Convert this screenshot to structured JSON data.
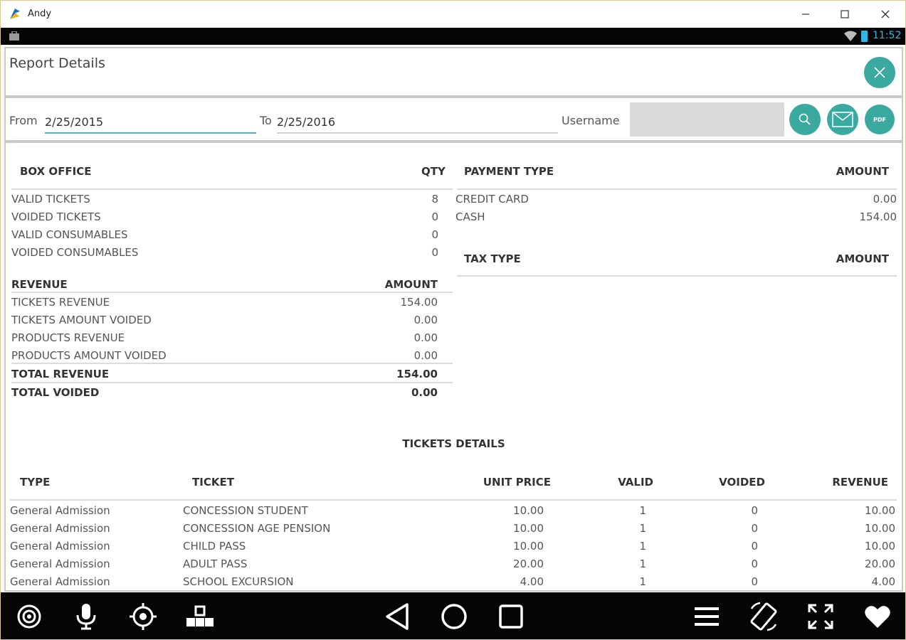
{
  "window": {
    "title": "Andy"
  },
  "statusbar": {
    "time": "11:52"
  },
  "header": {
    "title": "Report Details"
  },
  "filters": {
    "from_label": "From",
    "from_value": "2/25/2015",
    "to_label": "To",
    "to_value": "2/25/2016",
    "username_label": "Username",
    "username_value": "",
    "pdf_label": "PDF"
  },
  "box_office": {
    "headers": {
      "name": "BOX OFFICE",
      "qty": "QTY"
    },
    "rows": [
      {
        "label": "VALID TICKETS",
        "qty": "8"
      },
      {
        "label": "VOIDED TICKETS",
        "qty": "0"
      },
      {
        "label": "VALID CONSUMABLES",
        "qty": "0"
      },
      {
        "label": "VOIDED CONSUMABLES",
        "qty": "0"
      }
    ]
  },
  "revenue": {
    "headers": {
      "name": "REVENUE",
      "amount": "AMOUNT"
    },
    "rows": [
      {
        "label": "TICKETS REVENUE",
        "amount": "154.00"
      },
      {
        "label": "TICKETS AMOUNT VOIDED",
        "amount": "0.00"
      },
      {
        "label": "PRODUCTS REVENUE",
        "amount": "0.00"
      },
      {
        "label": "PRODUCTS AMOUNT VOIDED",
        "amount": "0.00"
      }
    ],
    "totals": [
      {
        "label": "TOTAL REVENUE",
        "amount": "154.00"
      },
      {
        "label": "TOTAL VOIDED",
        "amount": "0.00"
      }
    ]
  },
  "payment": {
    "headers": {
      "name": "PAYMENT TYPE",
      "amount": "AMOUNT"
    },
    "rows": [
      {
        "label": "CREDIT CARD",
        "amount": "0.00"
      },
      {
        "label": "CASH",
        "amount": "154.00"
      }
    ]
  },
  "tax": {
    "headers": {
      "name": "TAX TYPE",
      "amount": "AMOUNT"
    },
    "rows": []
  },
  "tickets": {
    "title": "TICKETS DETAILS",
    "headers": {
      "type": "TYPE",
      "ticket": "TICKET",
      "unit_price": "UNIT PRICE",
      "valid": "VALID",
      "voided": "VOIDED",
      "revenue": "REVENUE"
    },
    "rows": [
      {
        "type": "General Admission",
        "ticket": "CONCESSION STUDENT",
        "unit_price": "10.00",
        "valid": "1",
        "voided": "0",
        "revenue": "10.00"
      },
      {
        "type": "General Admission",
        "ticket": "CONCESSION AGE PENSION",
        "unit_price": "10.00",
        "valid": "1",
        "voided": "0",
        "revenue": "10.00"
      },
      {
        "type": "General Admission",
        "ticket": "CHILD PASS",
        "unit_price": "10.00",
        "valid": "1",
        "voided": "0",
        "revenue": "10.00"
      },
      {
        "type": "General Admission",
        "ticket": "ADULT PASS",
        "unit_price": "20.00",
        "valid": "1",
        "voided": "0",
        "revenue": "20.00"
      },
      {
        "type": "General Admission",
        "ticket": "SCHOOL EXCURSION",
        "unit_price": "4.00",
        "valid": "1",
        "voided": "0",
        "revenue": "4.00"
      }
    ]
  },
  "colors": {
    "accent": "#3aa9a0",
    "android_blue": "#33b5e5",
    "bar": "#050505"
  }
}
